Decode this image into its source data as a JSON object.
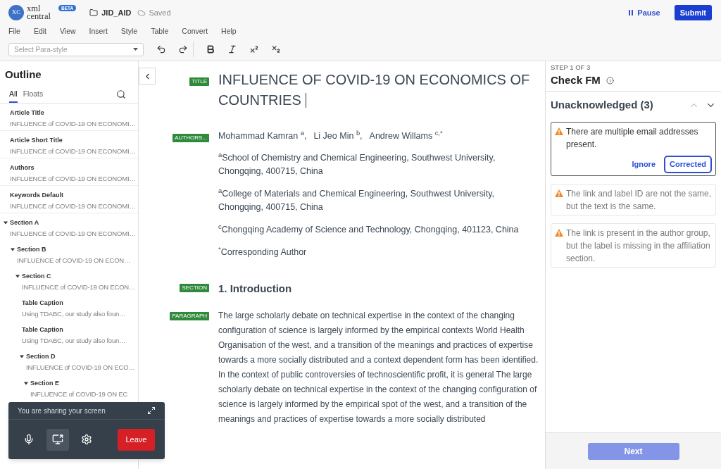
{
  "header": {
    "logo": {
      "mark": "XC",
      "wordmark": "xml central",
      "badge": "BETA"
    },
    "file_name": "JID_AID",
    "save_status": "Saved",
    "pause": "Pause",
    "submit": "Submit"
  },
  "menu": [
    "File",
    "Edit",
    "View",
    "Insert",
    "Style",
    "Table",
    "Convert",
    "Help"
  ],
  "toolbar": {
    "para_style": {
      "placeholder": "Select Para-style"
    },
    "tools": [
      {
        "kind": "undo"
      },
      {
        "kind": "redo"
      },
      {
        "kind": "separator"
      },
      {
        "kind": "bold"
      },
      {
        "kind": "italic"
      },
      {
        "kind": "superscript"
      },
      {
        "kind": "subscript"
      }
    ]
  },
  "outline": {
    "title": "Outline",
    "tabs": [
      {
        "label": "All",
        "selected": true
      },
      {
        "label": "Floats",
        "selected": false
      }
    ],
    "items": [
      {
        "label": "Article Title",
        "value": "INFLUENCE of COVID-19 ON ECONOMI…"
      },
      {
        "label": "Article Short Title",
        "value": "INFLUENCE of COVID-19 ON ECONOMI…"
      },
      {
        "label": "Authors",
        "value": "INFLUENCE of COVID-19 ON ECONOMI…"
      },
      {
        "label": "Keywords Default",
        "value": "INFLUENCE of COVID-19 ON ECONOMI…"
      },
      {
        "label": "Section A",
        "value": "INFLUENCE of COVID-19 ON ECONOMI…",
        "expanded": true,
        "children": [
          {
            "label": "Section B",
            "value": "INFLUENCE of COVID-19 ON ECON…",
            "expanded": true,
            "children": [
              {
                "label": "Section C",
                "value": "INFLUENCE of COVID-19 ON ECON…",
                "expanded": true,
                "children": [
                  {
                    "label": "Table Caption",
                    "value": "Using TDABC, our study also foun…"
                  },
                  {
                    "label": "Table Caption",
                    "value": "Using TDABC, our study also foun…"
                  },
                  {
                    "label": "Section D",
                    "value": "INFLUENCE of COVID-19 ON ECO…",
                    "expanded": true,
                    "children": [
                      {
                        "label": "Section E",
                        "value": "INFLUENCE of COVID-19 ON EC",
                        "expanded": true
                      }
                    ]
                  }
                ]
              }
            ]
          }
        ]
      }
    ]
  },
  "screen_share": {
    "message": "You are sharing your screen",
    "controls": [
      {
        "kind": "mic",
        "selected": false
      },
      {
        "kind": "screen",
        "selected": true
      },
      {
        "kind": "settings",
        "selected": false
      }
    ],
    "leave": "Leave"
  },
  "editor": {
    "blocks": [
      {
        "kind": "title",
        "tag": "TITLE",
        "text": "INFLUENCE OF COVID-19 ON ECONOMICS OF COUNTRIES"
      },
      {
        "kind": "authors",
        "tag": "AUTHORS...",
        "authors": [
          "Mohammad Kamran $^{a}$,",
          "Li Jeo Min $^{b}$,",
          "Andrew Willams $^{c,*}$"
        ],
        "affiliations": [
          "$^{a}$School of Chemistry and Chemical Engineering, Southwest University, Chongqing, 400715, China",
          "$^{a}$College of Materials and Chemical Engineering, Southwest University, Chongqing, 400715, China",
          "$^{c}$Chongqing Academy of Science and Technology, Chongqing, 401123, China",
          "$^{*}$Corresponding Author"
        ]
      },
      {
        "kind": "section",
        "tag": "SECTION",
        "heading": "1. Introduction"
      },
      {
        "kind": "paragraph",
        "tag": "PARAGRAPH",
        "text": "The large scholarly debate on technical expertise in the context of the changing configuration of science is largely informed by the empirical contexts World Health Organisation of the west, and a transition of the meanings and practices of expertise towards a more socially distributed and a context dependent form has been identified. In the context of public controversies of technoscientific profit, it is general The large scholarly debate on technical expertise in the context of the changing configuration of science is largely informed by the empirical spot of the west, and a transition of the meanings and practices of expertise towards a more socially distributed"
      }
    ]
  },
  "check_panel": {
    "step": "STEP 1 OF 3",
    "title": "Check FM",
    "group": {
      "title": "Unacknowledged (3)",
      "nav": [
        {
          "kind": "up",
          "disabled": true
        },
        {
          "kind": "down",
          "disabled": false
        }
      ],
      "issues": [
        {
          "text": "There are multiple email addresses present.",
          "selected": true,
          "actions": [
            {
              "kind": "text",
              "label": "Ignore"
            },
            {
              "kind": "outline",
              "label": "Corrected"
            }
          ]
        },
        {
          "text": "The link and label ID are not the same, but the text is the same.",
          "selected": false
        },
        {
          "text": "The link is present in the author group, but the label is missing in the affiliation section.",
          "selected": false
        }
      ]
    },
    "next": {
      "label": "Next",
      "disabled": true
    }
  }
}
